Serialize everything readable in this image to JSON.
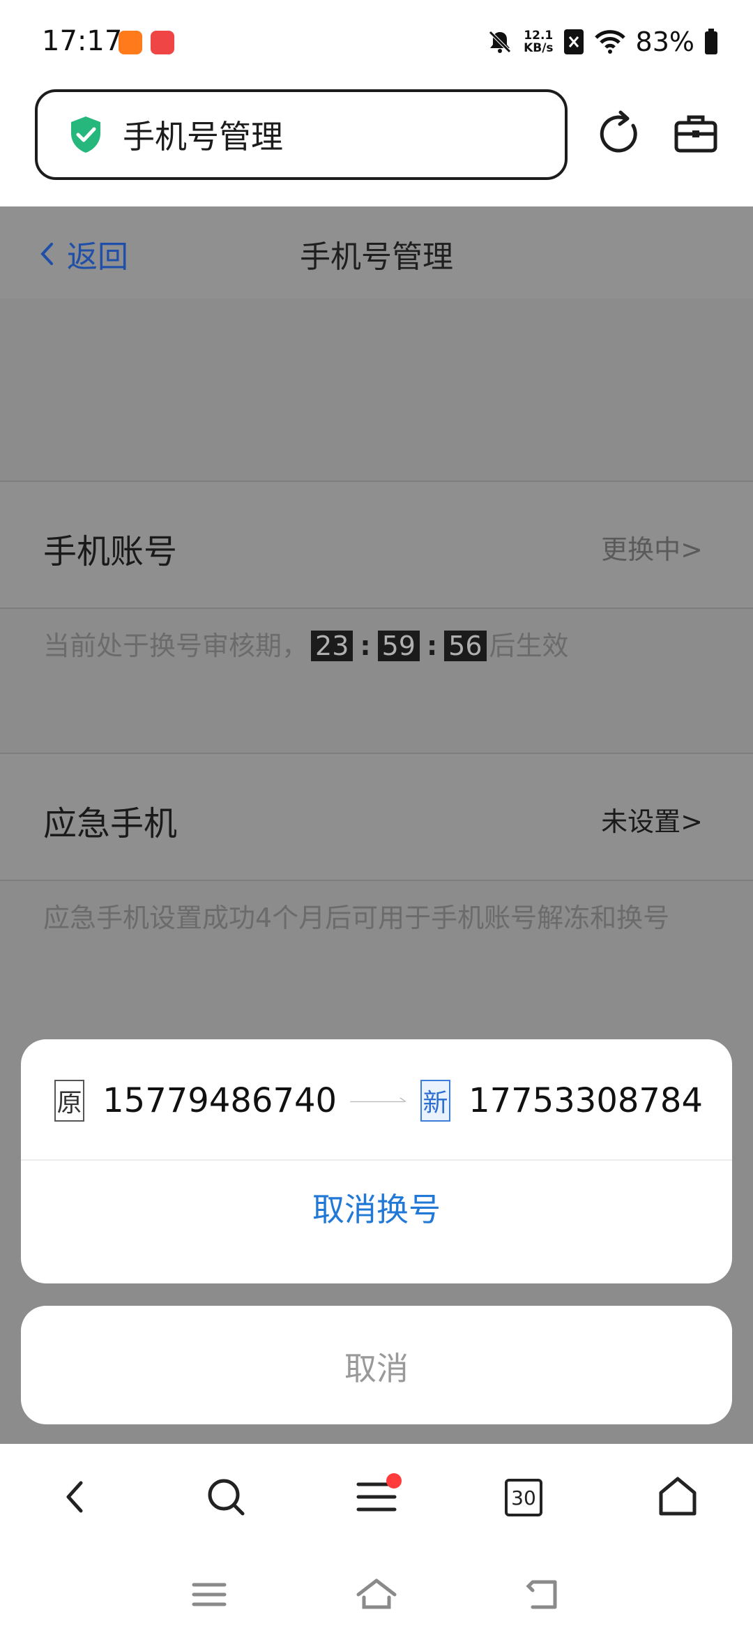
{
  "status_bar": {
    "time": "17:17",
    "net_speed_value": "12.1",
    "net_speed_unit": "KB/s",
    "battery": "83%",
    "icons": [
      "app-orange-icon",
      "huawei-app-icon",
      "bell-off-icon",
      "sim-x-icon",
      "wifi-icon",
      "battery-icon"
    ]
  },
  "browser": {
    "url_title": "手机号管理",
    "icons": [
      "shield-check-icon",
      "refresh-icon",
      "toolbox-icon"
    ]
  },
  "nav": {
    "back_label": "返回",
    "title": "手机号管理"
  },
  "account": {
    "label": "手机账号",
    "status": "更换中>",
    "desc_prefix": "当前处于换号审核期，",
    "countdown": [
      "23",
      "59",
      "56"
    ],
    "desc_suffix": "后生效"
  },
  "emergency": {
    "label": "应急手机",
    "status": "未设置>",
    "desc": "应急手机设置成功4个月后可用于手机账号解冻和换号"
  },
  "sheet": {
    "old_tag": "原",
    "old_number": "15779486740",
    "new_tag": "新",
    "new_number": "17753308784",
    "cancel_change": "取消换号",
    "cancel": "取消"
  },
  "toolbar": {
    "tabs_count": "30",
    "icons": [
      "back-icon",
      "search-icon",
      "menu-icon",
      "tabs-icon",
      "home-icon"
    ]
  },
  "colors": {
    "link_blue": "#1f4fa8",
    "action_blue": "#2178d6",
    "notify_red": "#ff3b3b"
  }
}
